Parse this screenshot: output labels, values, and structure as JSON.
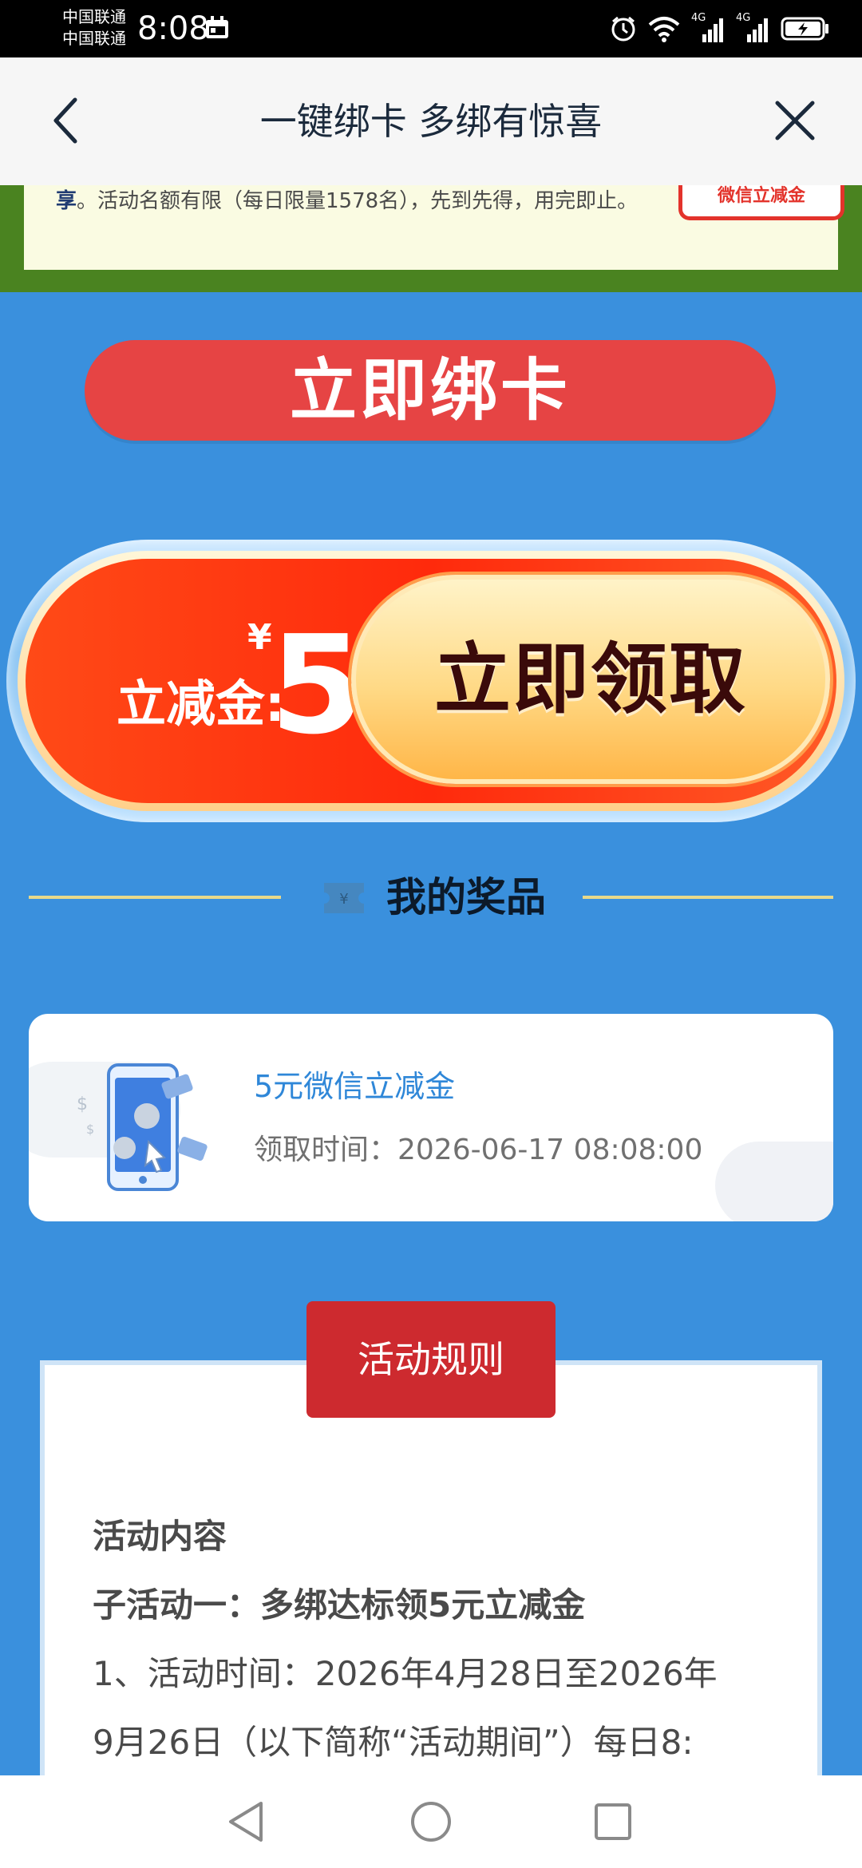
{
  "status_bar": {
    "carrier_1": "中国联通",
    "carrier_2": "中国联通",
    "time": "8:08",
    "network_1": "4G",
    "network_2": "4G"
  },
  "header": {
    "title": "一键绑卡 多绑有惊喜",
    "back_icon": "chevron-left-icon",
    "close_icon": "close-icon"
  },
  "notice": {
    "lead": "享",
    "text": "。活动名额有限（每日限量1578名），先到先得，用完即止。",
    "badge": "微信立减金"
  },
  "bind_button": {
    "label": "立即绑卡"
  },
  "coupon": {
    "label": "立减金:",
    "currency": "¥",
    "amount": "5",
    "claim_label": "立即领取"
  },
  "prizes": {
    "title": "我的奖品",
    "items": [
      {
        "name": "5元微信立减金",
        "time": "领取时间：2026-06-17 08:08:00"
      }
    ]
  },
  "rules": {
    "tab_label": "活动规则",
    "section_title": "活动内容",
    "sub_title": "子活动一：多绑达标领5元立减金",
    "line_1": "1、活动时间：2026年4月28日至2026年",
    "line_2": "9月26日（以下简称“活动期间”）每日8:"
  },
  "colors": {
    "background": "#3a90dd",
    "bind_button": "#e64444",
    "rules_tab": "#cd2a2f",
    "prize_name": "#2f87d8"
  }
}
